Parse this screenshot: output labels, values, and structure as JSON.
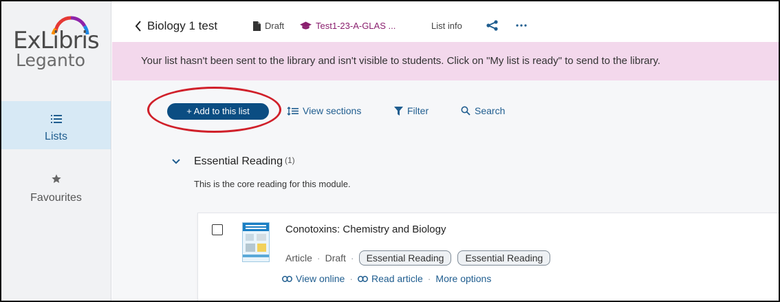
{
  "sidebar": {
    "logo_line1": "ExLibris",
    "logo_line2": "Leganto",
    "items": [
      {
        "label": "Lists",
        "icon": "list-icon",
        "active": true
      },
      {
        "label": "Favourites",
        "icon": "star-icon",
        "active": false
      }
    ]
  },
  "header": {
    "back_icon": "chevron-left-icon",
    "list_title": "Biology 1 test",
    "status_label": "Draft",
    "course_label": "Test1-23-A-GLAS ...",
    "list_info_label": "List info",
    "share_icon": "share-icon",
    "more_icon": "more-icon"
  },
  "banner": {
    "message": "Your list hasn't been sent to the library and isn't visible to students. Click on \"My list is ready\" to send to the library."
  },
  "toolbar": {
    "add_label": "+ Add to this list",
    "view_sections_label": "View sections",
    "filter_label": "Filter",
    "search_label": "Search"
  },
  "section": {
    "title": "Essential Reading",
    "count": "(1)",
    "description": "This is the core reading for this module."
  },
  "item": {
    "title": "Conotoxins: Chemistry and Biology",
    "type": "Article",
    "status": "Draft",
    "tags": [
      "Essential Reading",
      "Essential Reading"
    ],
    "actions": {
      "view_online": "View online",
      "read_article": "Read article",
      "more_options": "More options"
    }
  },
  "colors": {
    "accent": "#0b4d82",
    "banner_bg": "#f3d8ec",
    "sidebar_bg": "#f1f2f4",
    "active_nav_bg": "#d7e9f5",
    "annotation_circle": "#d0202a",
    "course_icon": "#8a1f6e"
  }
}
